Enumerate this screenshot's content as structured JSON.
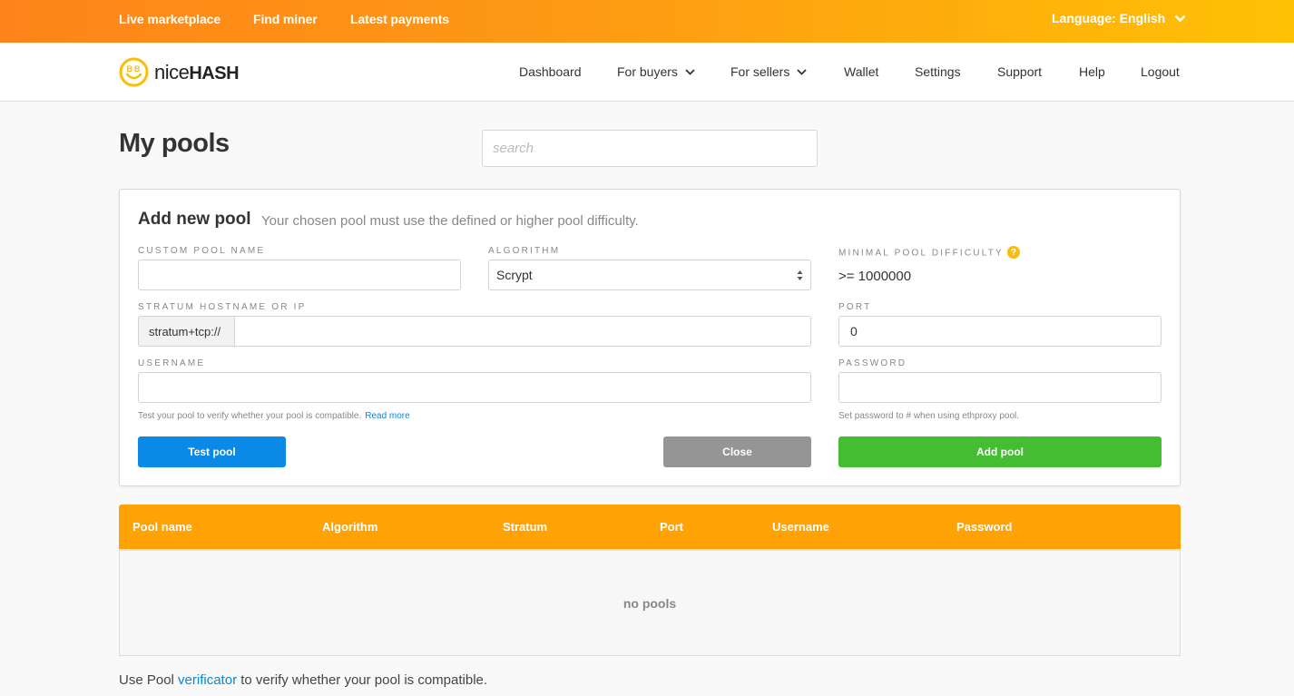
{
  "topbar": {
    "links": [
      "Live marketplace",
      "Find miner",
      "Latest payments"
    ],
    "language_label": "Language: English"
  },
  "brand": {
    "logo_light": "nice",
    "logo_bold": "HASH"
  },
  "nav": {
    "items": [
      {
        "label": "Dashboard",
        "dropdown": false
      },
      {
        "label": "For buyers",
        "dropdown": true
      },
      {
        "label": "For sellers",
        "dropdown": true
      },
      {
        "label": "Wallet",
        "dropdown": false
      },
      {
        "label": "Settings",
        "dropdown": false
      },
      {
        "label": "Support",
        "dropdown": false
      },
      {
        "label": "Help",
        "dropdown": false
      },
      {
        "label": "Logout",
        "dropdown": false
      }
    ]
  },
  "page": {
    "title": "My pools",
    "search": {
      "placeholder": "search",
      "value": ""
    }
  },
  "add_pool": {
    "title": "Add new pool",
    "subtitle": "Your chosen pool must use the defined or higher pool difficulty.",
    "fields": {
      "custom_pool_name": {
        "label": "Custom pool name",
        "value": ""
      },
      "algorithm": {
        "label": "Algorithm",
        "selected": "Scrypt"
      },
      "minimal_difficulty": {
        "label": "Minimal pool difficulty",
        "value": ">= 1000000"
      },
      "stratum": {
        "label": "Stratum hostname or IP",
        "prefix": "stratum+tcp://",
        "value": ""
      },
      "port": {
        "label": "Port",
        "value": "0"
      },
      "username": {
        "label": "Username",
        "value": ""
      },
      "password": {
        "label": "Password",
        "value": ""
      }
    },
    "test_hint": "Test your pool to verify whether your pool is compatible.",
    "read_more": "Read more",
    "password_hint": "Set password to # when using ethproxy pool.",
    "buttons": {
      "test": "Test pool",
      "close": "Close",
      "add": "Add pool"
    }
  },
  "pools_table": {
    "columns": [
      "Pool name",
      "Algorithm",
      "Stratum",
      "Port",
      "Username",
      "Password"
    ],
    "rows": [],
    "empty_text": "no pools"
  },
  "footer_note": {
    "before": "Use Pool ",
    "link": "verificator",
    "after": " to verify whether your pool is compatible."
  },
  "colors": {
    "topbar_start": "#fe8419",
    "topbar_end": "#ffc105",
    "table_header": "#ffa205",
    "primary_blue": "#0a8ae6",
    "close_gray": "#959595",
    "add_green": "#44bd32",
    "link_blue": "#0b86d8",
    "help_yellow": "#fbbd0c"
  }
}
